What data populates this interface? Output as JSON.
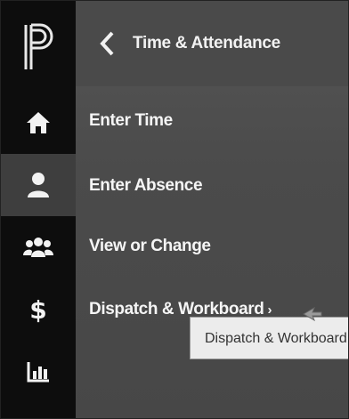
{
  "header": {
    "title": "Time & Attendance"
  },
  "menu": {
    "items": [
      {
        "label": "Enter Time"
      },
      {
        "label": "Enter Absence"
      },
      {
        "label": "View or Change"
      },
      {
        "label": "Dispatch & Workboard",
        "chevron": "›"
      }
    ]
  },
  "tooltip": {
    "text": "Dispatch & Workboard"
  },
  "rail": {
    "items": [
      "logo-icon",
      "home-icon",
      "user-icon",
      "group-icon",
      "dollar-icon",
      "chart-icon"
    ],
    "dollar_glyph": "$"
  },
  "colors": {
    "rail_bg": "#0d0d0d",
    "panel_bg": "#474747",
    "text": "#f5f5f5",
    "tooltip_bg": "#ececec"
  }
}
